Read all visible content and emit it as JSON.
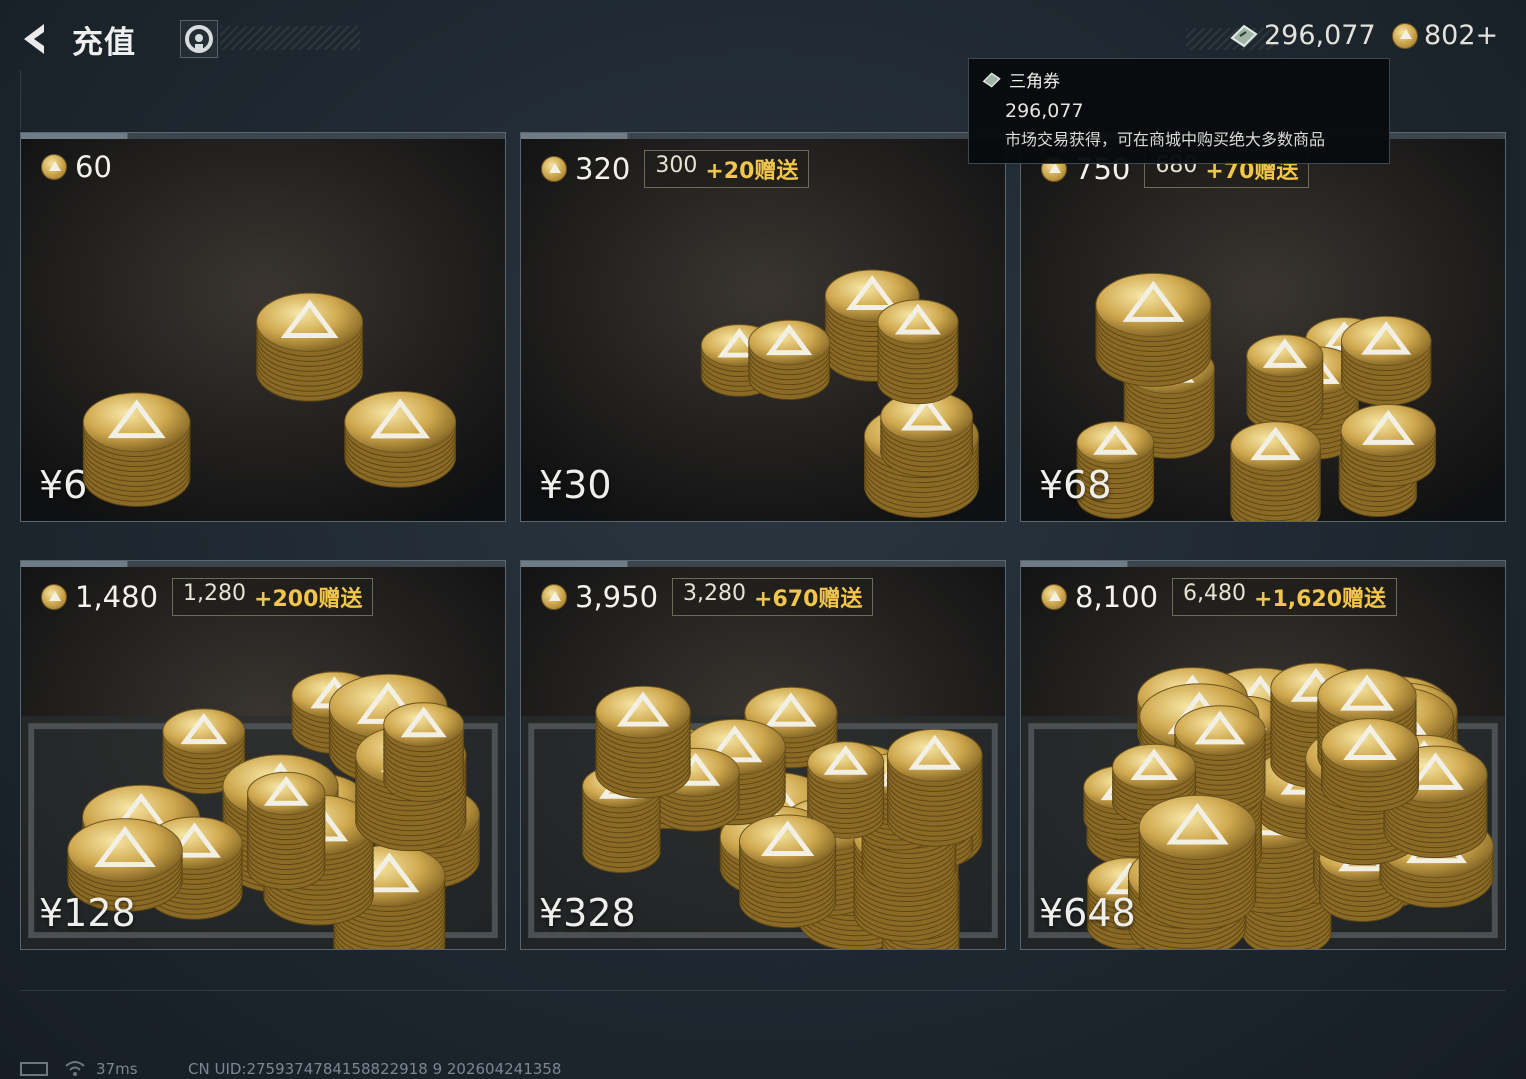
{
  "header": {
    "title": "充值",
    "back_icon": "chevron-left-icon",
    "service_icon": "support-icon"
  },
  "currency": {
    "ticket_amount": "296,077",
    "coin_amount": "802+"
  },
  "tooltip": {
    "title": "三角券",
    "amount": "296,077",
    "description": "市场交易获得，可在商城中购买绝大多数商品"
  },
  "packages": [
    {
      "amount": "60",
      "base": "",
      "bonus": "",
      "price": "¥6"
    },
    {
      "amount": "320",
      "base": "300",
      "bonus": "+20赠送",
      "price": "¥30"
    },
    {
      "amount": "750",
      "base": "680",
      "bonus": "+70赠送",
      "price": "¥68"
    },
    {
      "amount": "1,480",
      "base": "1,280",
      "bonus": "+200赠送",
      "price": "¥128"
    },
    {
      "amount": "3,950",
      "base": "3,280",
      "bonus": "+670赠送",
      "price": "¥328"
    },
    {
      "amount": "8,100",
      "base": "6,480",
      "bonus": "+1,620赠送",
      "price": "¥648"
    }
  ],
  "footer": {
    "ping": "37ms",
    "uid": "CN UID:2759374784158822918 9 202604241358"
  },
  "colors": {
    "bonus_gold": "#f2c64a",
    "background": "#1f2830"
  }
}
